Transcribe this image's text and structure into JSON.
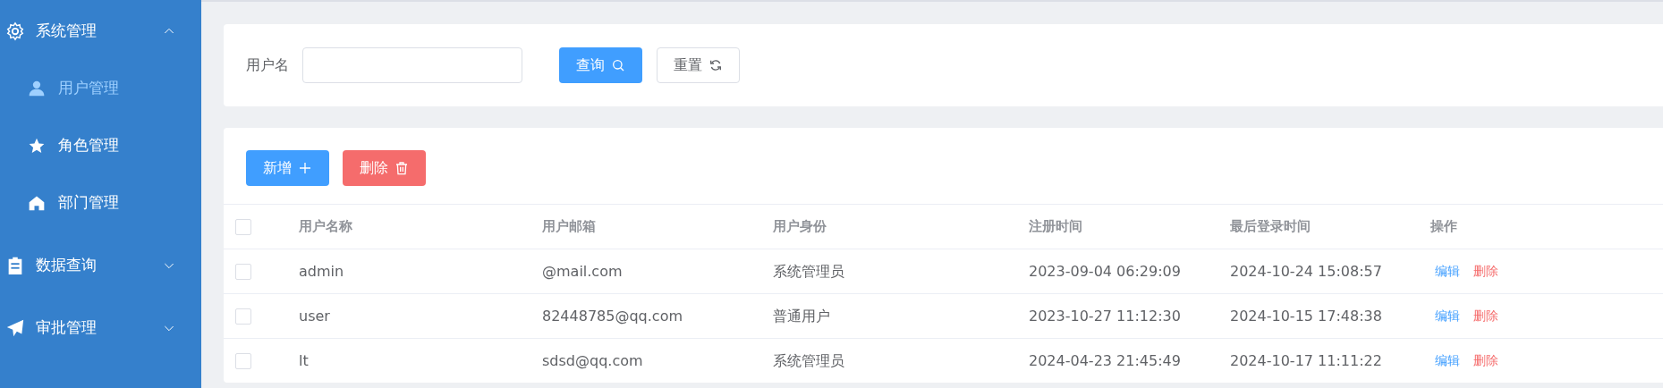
{
  "sidebar": {
    "items": [
      {
        "label": "系统管理",
        "expanded": true,
        "selected": false,
        "children": [
          {
            "label": "用户管理",
            "selected": true
          },
          {
            "label": "角色管理",
            "selected": false
          },
          {
            "label": "部门管理",
            "selected": false
          }
        ]
      },
      {
        "label": "数据查询",
        "expanded": false,
        "selected": false
      },
      {
        "label": "审批管理",
        "expanded": false,
        "selected": false
      }
    ]
  },
  "search": {
    "label": "用户名",
    "buttons": [
      {
        "label": "查询",
        "kind": "primary"
      },
      {
        "label": "重置",
        "kind": "plain"
      }
    ]
  },
  "toolbar": {
    "buttons": [
      {
        "label": "新增",
        "kind": "primary"
      },
      {
        "label": "删除",
        "kind": "danger"
      }
    ]
  },
  "table": {
    "select_all": {
      "checked": false
    },
    "columns": [
      "用户名称",
      "用户邮箱",
      "用户身份",
      "注册时间",
      "最后登录时间",
      "操作"
    ],
    "rows": [
      {
        "checked": false,
        "cells": [
          "admin",
          "@mail.com",
          "系统管理员",
          "2023-09-04 06:29:09",
          "2024-10-24 15:08:57"
        ],
        "actions": [
          "编辑",
          "删除"
        ]
      },
      {
        "checked": false,
        "cells": [
          "user",
          "82448785@qq.com",
          "普通用户",
          "2023-10-27 11:12:30",
          "2024-10-15 17:48:38"
        ],
        "actions": [
          "编辑",
          "删除"
        ]
      },
      {
        "checked": false,
        "cells": [
          "lt",
          "sdsd@qq.com",
          "系统管理员",
          "2024-04-23 21:45:49",
          "2024-10-17 11:11:22"
        ],
        "actions": [
          "编辑",
          "删除"
        ]
      }
    ]
  }
}
